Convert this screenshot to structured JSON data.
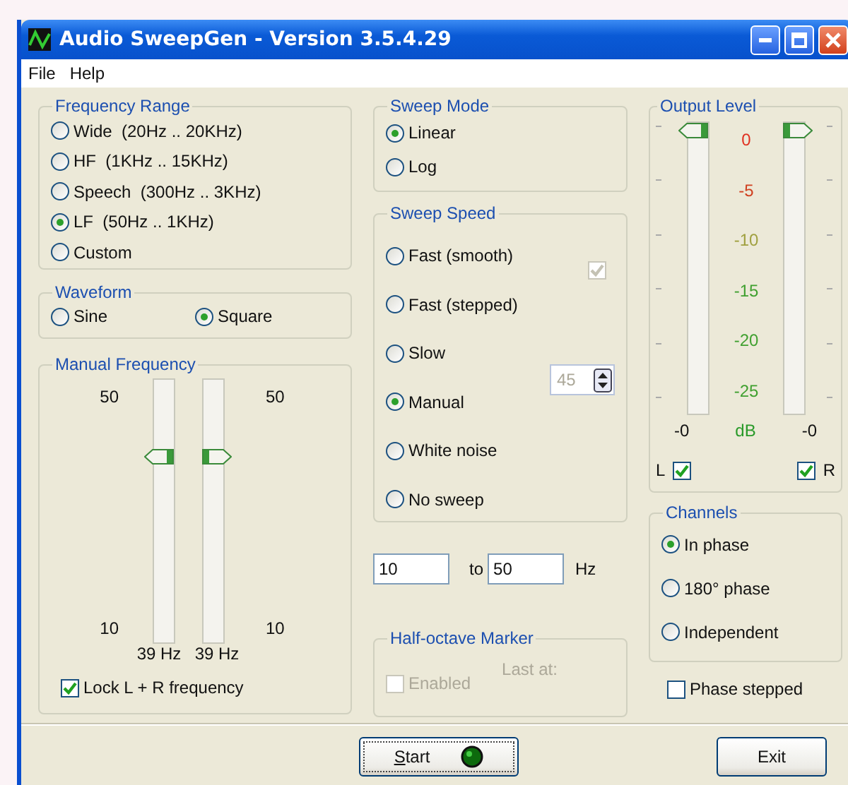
{
  "window": {
    "title": "Audio SweepGen - Version 3.5.4.29"
  },
  "menu": [
    "File",
    "Help"
  ],
  "frequency_range": {
    "title": "Frequency Range",
    "options": [
      {
        "label": "Wide  (20Hz .. 20KHz)",
        "selected": false
      },
      {
        "label": "HF  (1KHz .. 15KHz)",
        "selected": false
      },
      {
        "label": "Speech  (300Hz .. 3KHz)",
        "selected": false
      },
      {
        "label": "LF  (50Hz .. 1KHz)",
        "selected": true
      },
      {
        "label": "Custom",
        "selected": false
      }
    ]
  },
  "waveform": {
    "title": "Waveform",
    "options": [
      {
        "label": "Sine",
        "selected": false
      },
      {
        "label": "Square",
        "selected": true
      }
    ]
  },
  "manual_frequency": {
    "title": "Manual Frequency",
    "sliders": [
      {
        "kind": "left",
        "top_label": "50",
        "bottom_label": "10",
        "level": 0.72,
        "reading": "39 Hz"
      },
      {
        "kind": "right",
        "top_label": "50",
        "bottom_label": "10",
        "level": 0.72,
        "reading": "39 Hz"
      }
    ],
    "lock": {
      "label": "Lock L + R frequency",
      "checked": true
    }
  },
  "sweep_mode": {
    "title": "Sweep Mode",
    "options": [
      {
        "label": "Linear",
        "selected": true
      },
      {
        "label": "Log",
        "selected": false
      }
    ]
  },
  "sweep_speed": {
    "title": "Sweep Speed",
    "options": [
      {
        "label": "Fast (smooth)",
        "selected": false
      },
      {
        "label": "Fast (stepped)",
        "selected": false
      },
      {
        "label": "Slow",
        "selected": false
      },
      {
        "label": "Manual",
        "selected": true
      },
      {
        "label": "White noise",
        "selected": false
      },
      {
        "label": "No sweep",
        "selected": false
      }
    ],
    "smooth_check": {
      "checked": true,
      "disabled": true
    },
    "step_spin": {
      "value": "45",
      "disabled": true
    }
  },
  "range": {
    "from": "10",
    "to_label": "to",
    "to": "50",
    "unit": "Hz"
  },
  "half_octave": {
    "title": "Half-octave Marker",
    "enabled": {
      "label": "Enabled",
      "checked": false,
      "disabled": true
    },
    "last_at": "Last at:"
  },
  "output_level": {
    "title": "Output Level",
    "sliders": [
      {
        "kind": "left",
        "level": 1
      },
      {
        "kind": "right",
        "level": 1
      }
    ],
    "scale": [
      {
        "label": "0",
        "color": "#e03020"
      },
      {
        "label": "-5",
        "color": "#d04020"
      },
      {
        "label": "-10",
        "color": "#a0a040"
      },
      {
        "label": "-15",
        "color": "#40a030"
      },
      {
        "label": "-20",
        "color": "#40a030"
      },
      {
        "label": "-25",
        "color": "#40a030"
      }
    ],
    "left_reading": "-0",
    "unit": "dB",
    "right_reading": "-0",
    "channel_checks": [
      {
        "kind": "left",
        "label": "L",
        "checked": true
      },
      {
        "kind": "right",
        "label": "R",
        "checked": true
      }
    ]
  },
  "channels": {
    "title": "Channels",
    "options": [
      {
        "label": "In phase",
        "selected": true
      },
      {
        "label": "180° phase",
        "selected": false
      },
      {
        "label": "Independent",
        "selected": false
      }
    ]
  },
  "phase_stepped": {
    "label": "Phase stepped",
    "checked": false
  },
  "buttons": [
    {
      "kind": "start",
      "label": "Start"
    },
    {
      "kind": "exit",
      "label": "Exit"
    }
  ]
}
